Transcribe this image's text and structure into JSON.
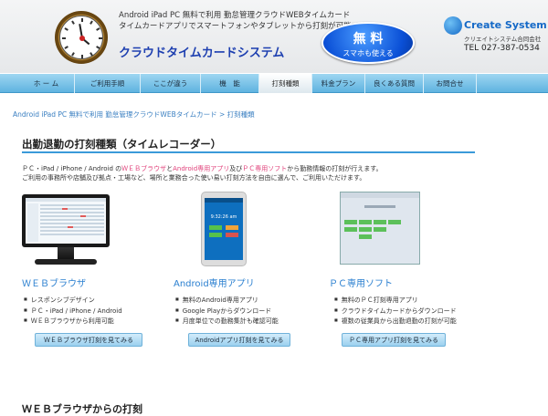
{
  "header": {
    "tagline_line1": "Android iPad PC 無料で利用 勤怠管理クラウドWEBタイムカード",
    "tagline_line2": "タイムカードアプリでスマートフォンやタブレットから打刻が可能です。",
    "product_title": "クラウドタイムカードシステム",
    "free_badge_main": "無 料",
    "free_badge_sub": "スマホも使える",
    "company_name": "Create System",
    "company_name_jp": "クリエイトシステム合同会社",
    "company_tel": "TEL 027-387-0534"
  },
  "nav": {
    "items": [
      {
        "label": "ホ ー ム"
      },
      {
        "label": "ご利用手順"
      },
      {
        "label": "ここが違う"
      },
      {
        "label": "機　能"
      },
      {
        "label": "打刻種類"
      },
      {
        "label": "料金プラン"
      },
      {
        "label": "良くある質問"
      },
      {
        "label": "お問合せ"
      }
    ],
    "active_index": 4
  },
  "breadcrumb": {
    "home": "Android iPad PC 無料で利用 勤怠管理クラウドWEBタイムカード",
    "separator": " > ",
    "current": "打刻種類"
  },
  "main": {
    "section_title": "出勤退勤の打刻種類（タイムレコーダー）",
    "intro": {
      "p1": "ＰＣ・iPad / iPhone / Android の",
      "hl1": "ＷＥＢブラウザ",
      "p2": "と",
      "hl2": "Android専用アプリ",
      "p3": "及び",
      "hl3": "ＰＣ専用ソフト",
      "p4": "から勤務情報の打刻が行えます。",
      "line2": "ご利用の事務所や店舗及び拠点・工場など、場所と業務合った使い易い打刻方法を自由に選んで、ご利用いただけます。"
    },
    "columns": [
      {
        "title": "ＷＥＢブラウザ",
        "features": [
          "レスポンシブデザイン",
          "ＰＣ・iPad / iPhone / Android",
          "ＷＥＢブラウザから利用可能"
        ],
        "button": "ＷＥＢブラウザ打刻を見てみる"
      },
      {
        "title": "Android専用アプリ",
        "features": [
          "無料のAndroid専用アプリ",
          "Google Playからダウンロード",
          "月度単位での勤務集計も確認可能"
        ],
        "button": "Androidアプリ打刻を見てみる",
        "phone_time": "9:32:26 am"
      },
      {
        "title": "ＰＣ専用ソフト",
        "features": [
          "無料のＰＣ打刻専用アプリ",
          "クラウドタイムカードからダウンロード",
          "複数の従業員から出勤退勤の打刻が可能"
        ],
        "button": "ＰＣ専用アプリ打刻を見てみる"
      }
    ],
    "next_section_title": "ＷＥＢブラウザからの打刻"
  },
  "colors": {
    "nav_bg": "#6bbbe5",
    "accent_blue": "#2a7fd0",
    "highlight_pink": "#e0407a",
    "badge_blue": "#0a4fd6",
    "title_blue": "#1d3fb0"
  },
  "icons": [
    "clock-logo-icon",
    "company-logo-icon",
    "monitor-icon",
    "smartphone-icon",
    "pc-window-icon"
  ]
}
